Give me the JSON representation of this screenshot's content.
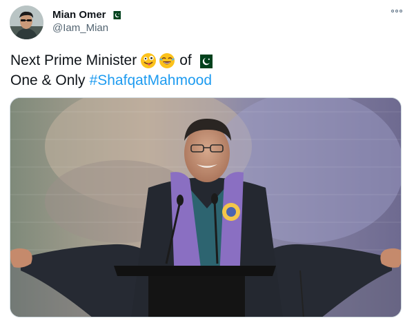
{
  "author": {
    "name": "Mian Omer",
    "handle": "@Iam_Mian",
    "flag_icon": "pakistan-flag-icon"
  },
  "tweet": {
    "line1_text": "Next Prime Minister",
    "line1_emojis": [
      "winking-face-with-tongue-emoji",
      "face-with-tears-of-joy-emoji"
    ],
    "line1_suffix": "of",
    "line1_flag": "pakistan-flag-icon",
    "line2_text": "One & Only",
    "hashtag": "#ShafqatMahmood"
  },
  "media": {
    "image_subject": "man-at-podium-photo"
  },
  "colors": {
    "hashtag": "#1d9bf0",
    "flag_green": "#01411c",
    "scarf_purple": "#8a6fc2"
  }
}
